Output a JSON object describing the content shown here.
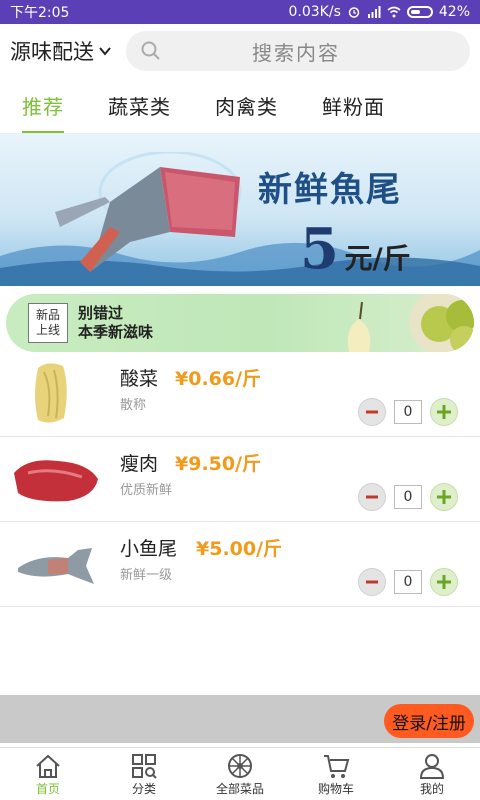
{
  "status": {
    "time": "下午2:05",
    "network": "0.03K/s",
    "battery": "42%"
  },
  "header": {
    "location": "源味配送",
    "search_placeholder": "搜索内容"
  },
  "tabs": [
    {
      "label": "推荐",
      "active": true
    },
    {
      "label": "蔬菜类",
      "active": false
    },
    {
      "label": "肉禽类",
      "active": false
    },
    {
      "label": "鲜粉面",
      "active": false
    }
  ],
  "banner": {
    "title": "新鲜魚尾",
    "price_number": "5",
    "price_unit": "元/斤"
  },
  "promo": {
    "badge_line1": "新品",
    "badge_line2": "上线",
    "line1": "别错过",
    "line2": "本季新滋味"
  },
  "products": [
    {
      "name": "酸菜",
      "price": "¥0.66/斤",
      "desc": "散称",
      "qty": "0",
      "image": "cabbage"
    },
    {
      "name": "瘦肉",
      "price": "¥9.50/斤",
      "desc": "优质新鲜",
      "qty": "0",
      "image": "meat"
    },
    {
      "name": "小鱼尾",
      "price": "¥5.00/斤",
      "desc": "新鲜一级",
      "qty": "0",
      "image": "fish"
    }
  ],
  "login_button": "登录/注册",
  "bottom_nav": [
    {
      "label": "首页",
      "icon": "home-icon",
      "active": true
    },
    {
      "label": "分类",
      "icon": "grid-icon",
      "active": false
    },
    {
      "label": "全部菜品",
      "icon": "wheel-icon",
      "active": false
    },
    {
      "label": "购物车",
      "icon": "cart-icon",
      "active": false
    },
    {
      "label": "我的",
      "icon": "user-icon",
      "active": false
    }
  ],
  "colors": {
    "accent_green": "#7cc13a",
    "price_orange": "#f29a1a",
    "login_orange": "#ff5a1f",
    "statusbar_purple": "#5a3fb6"
  }
}
